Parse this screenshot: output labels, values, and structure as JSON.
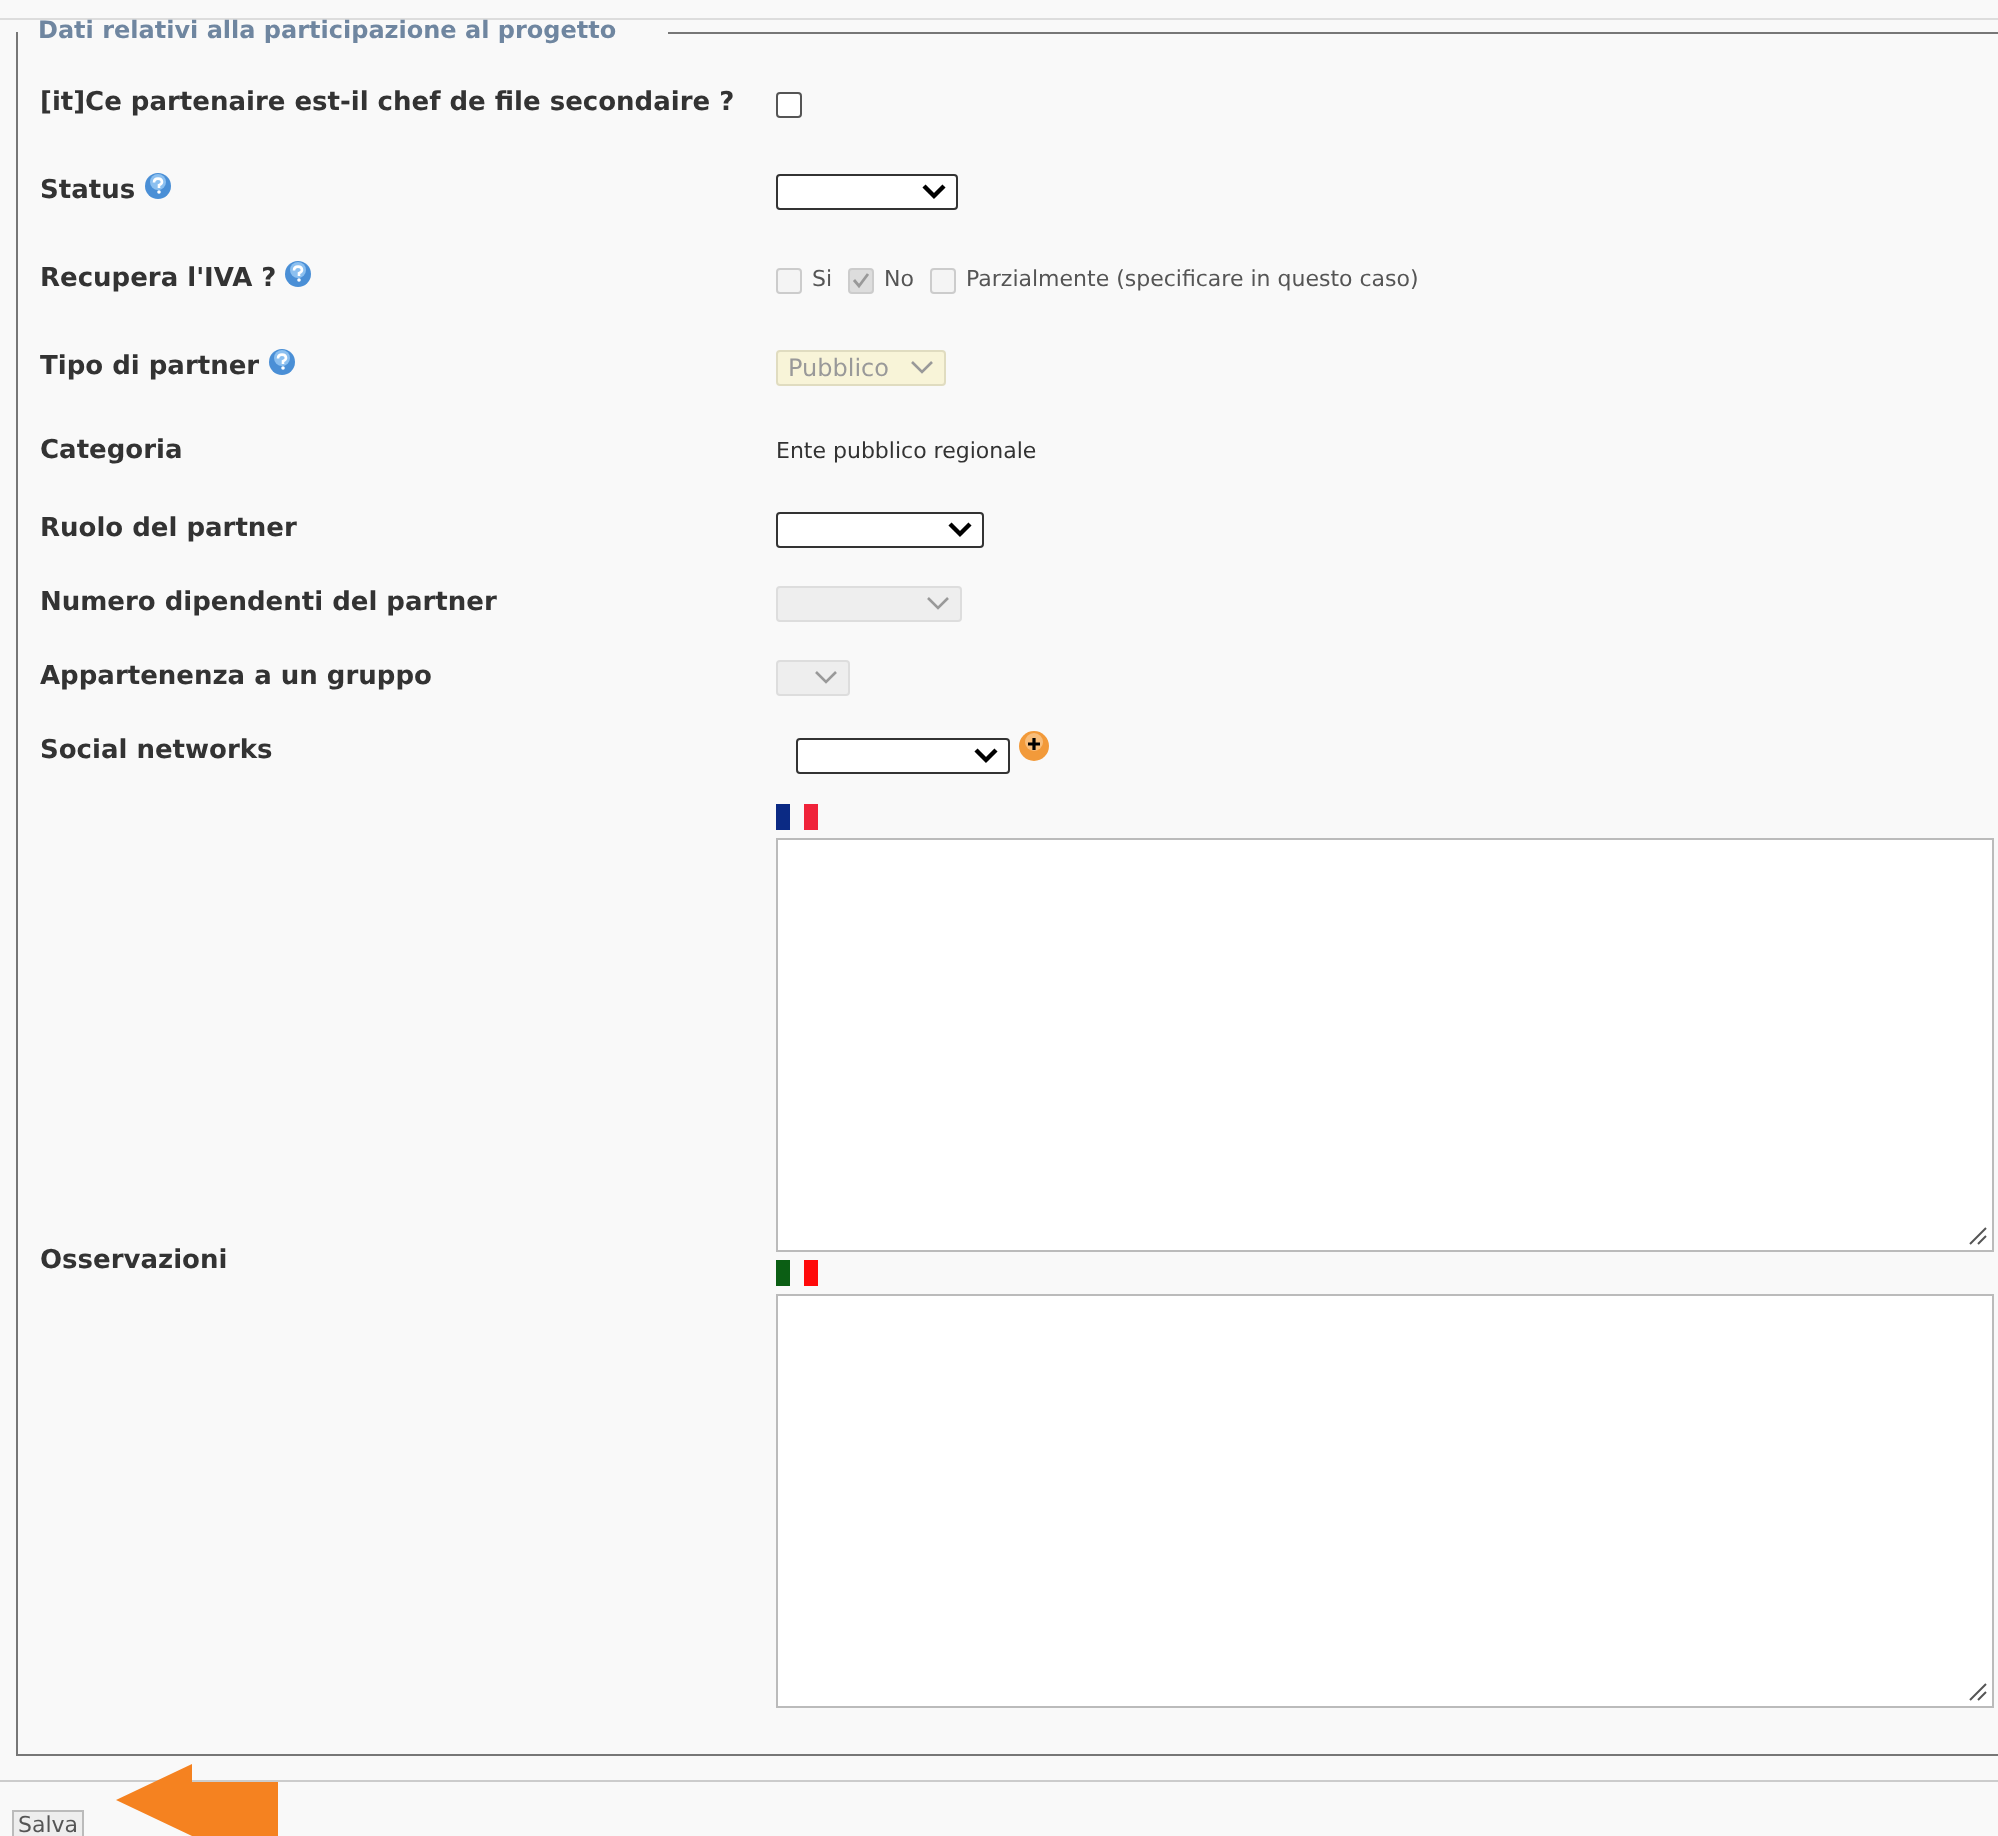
{
  "section": {
    "legend": "Dati relativi alla participazione al progetto",
    "fields": [
      {
        "kind": "checkbox",
        "label": "[it]Ce partenaire est-il chef de file secondaire ?",
        "help": false,
        "checked": false
      },
      {
        "kind": "select",
        "label": "Status",
        "help": true,
        "disabled": false
      },
      {
        "kind": "options",
        "label": "Recupera l'IVA ?",
        "help": true,
        "options": [
          {
            "label": "Si",
            "checked": false,
            "disabled": true
          },
          {
            "label": "No",
            "checked": true,
            "disabled": true
          },
          {
            "label": "Parzialmente (specificare in questo caso)",
            "checked": false,
            "disabled": true
          }
        ]
      },
      {
        "kind": "select",
        "label": "Tipo di partner",
        "help": true,
        "disabled": true,
        "value": "Pubblico"
      },
      {
        "kind": "text",
        "label": "Categoria",
        "help": false,
        "value": "Ente pubblico regionale"
      },
      {
        "kind": "select",
        "label": "Ruolo del partner",
        "help": false,
        "disabled": false
      },
      {
        "kind": "select",
        "label": "Numero dipendenti del partner",
        "help": false,
        "disabled": true
      },
      {
        "kind": "select",
        "label": "Appartenenza a un gruppo",
        "help": false,
        "disabled": true
      },
      {
        "kind": "select-add",
        "label": "Social networks",
        "help": false,
        "disabled": false
      }
    ],
    "observations": {
      "label": "Osservazioni",
      "editors": [
        {
          "kind": "french"
        },
        {
          "kind": "italian"
        }
      ]
    }
  },
  "save_button": "Salva"
}
